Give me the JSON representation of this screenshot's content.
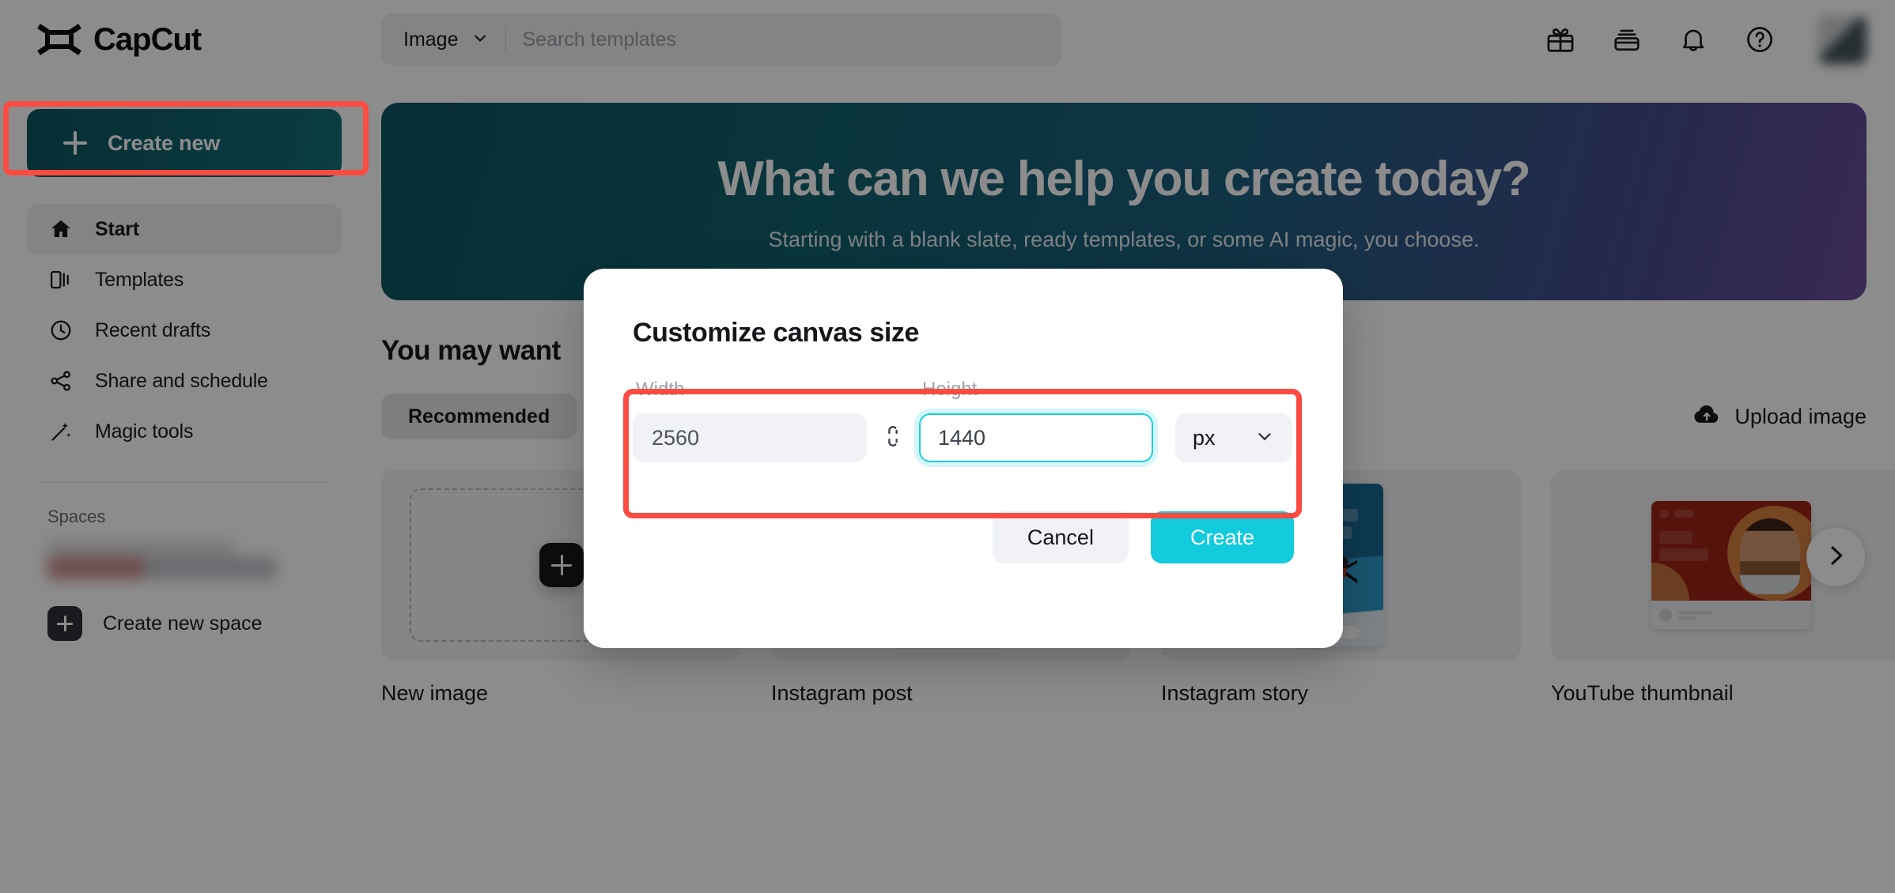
{
  "brand": {
    "name": "CapCut",
    "logo_icon": "capcut-logo-icon"
  },
  "sidebar": {
    "create_new": {
      "label": "Create new",
      "icon": "plus-icon"
    },
    "items": [
      {
        "label": "Start",
        "icon": "home-icon",
        "active": true
      },
      {
        "label": "Templates",
        "icon": "templates-icon",
        "active": false
      },
      {
        "label": "Recent drafts",
        "icon": "clock-icon",
        "active": false
      },
      {
        "label": "Share and schedule",
        "icon": "share-icon",
        "active": false
      },
      {
        "label": "Magic tools",
        "icon": "magic-wand-icon",
        "active": false
      }
    ],
    "spaces_title": "Spaces",
    "create_space": {
      "label": "Create new space",
      "icon": "plus-square-icon"
    }
  },
  "header": {
    "search_type": "Image",
    "search_type_icon": "chevron-down-icon",
    "search_placeholder": "Search templates",
    "search_value": "",
    "icons": [
      "gift-icon",
      "wallet-icon",
      "bell-icon",
      "help-circle-icon"
    ],
    "avatar": "avatar"
  },
  "hero": {
    "title": "What can we help you create today?",
    "subtitle": "Starting with a blank slate, ready templates, or some AI magic, you choose."
  },
  "section": {
    "title": "You may want",
    "chips": [
      {
        "label": "Recommended",
        "active": true
      }
    ],
    "upload": {
      "label": "Upload image",
      "icon": "cloud-upload-icon"
    },
    "next_icon": "chevron-right-icon"
  },
  "cards": [
    {
      "label": "New image",
      "thumb": "new-image-placeholder"
    },
    {
      "label": "Instagram post",
      "thumb": "instagram-post-preview"
    },
    {
      "label": "Instagram story",
      "thumb": "instagram-story-preview"
    },
    {
      "label": "YouTube thumbnail",
      "thumb": "youtube-thumbnail-preview"
    }
  ],
  "modal": {
    "title": "Customize canvas size",
    "width": {
      "label": "Width",
      "value": "2560",
      "focused": false
    },
    "height": {
      "label": "Height",
      "value": "1440",
      "focused": true
    },
    "link_icon": "unlink-icon",
    "unit": {
      "value": "px",
      "icon": "chevron-down-icon"
    },
    "cancel_label": "Cancel",
    "create_label": "Create"
  },
  "colors": {
    "accent_cyan": "#12cbdd",
    "focus_ring": "#19d0e0",
    "annotation_red": "#fc4b41",
    "create_new_teal": "#11636d"
  }
}
